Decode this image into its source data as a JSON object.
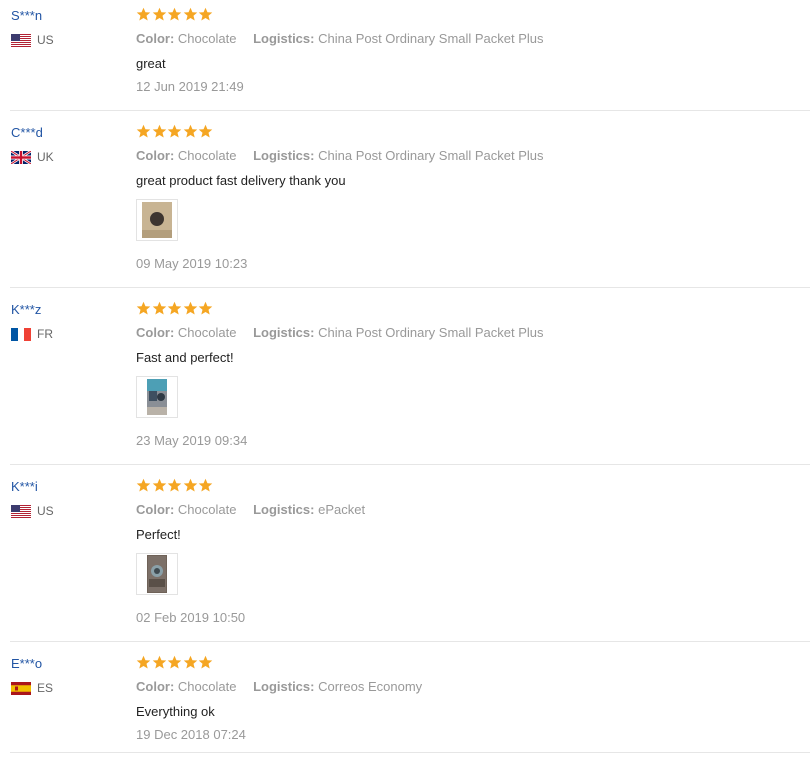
{
  "reviews": [
    {
      "name": "S***n",
      "country": "US",
      "flag_icon": "us-flag-icon",
      "rating": 5,
      "color_label": "Color:",
      "color_value": "Chocolate",
      "logistics_label": "Logistics:",
      "logistics_value": "China Post Ordinary Small Packet Plus",
      "text": "great",
      "date": "12 Jun 2019 21:49",
      "has_photo": false
    },
    {
      "name": "C***d",
      "country": "UK",
      "flag_icon": "uk-flag-icon",
      "rating": 5,
      "color_label": "Color:",
      "color_value": "Chocolate",
      "logistics_label": "Logistics:",
      "logistics_value": "China Post Ordinary Small Packet Plus",
      "text": "great product fast delivery thank you",
      "date": "09 May 2019 10:23",
      "has_photo": true
    },
    {
      "name": "K***z",
      "country": "FR",
      "flag_icon": "fr-flag-icon",
      "rating": 5,
      "color_label": "Color:",
      "color_value": "Chocolate",
      "logistics_label": "Logistics:",
      "logistics_value": "China Post Ordinary Small Packet Plus",
      "text": "Fast and perfect!",
      "date": "23 May 2019 09:34",
      "has_photo": true
    },
    {
      "name": "K***i",
      "country": "US",
      "flag_icon": "us-flag-icon",
      "rating": 5,
      "color_label": "Color:",
      "color_value": "Chocolate",
      "logistics_label": "Logistics:",
      "logistics_value": "ePacket",
      "text": "Perfect!",
      "date": "02 Feb 2019 10:50",
      "has_photo": true
    },
    {
      "name": "E***o",
      "country": "ES",
      "flag_icon": "es-flag-icon",
      "rating": 5,
      "color_label": "Color:",
      "color_value": "Chocolate",
      "logistics_label": "Logistics:",
      "logistics_value": "Correos Economy",
      "text": "Everything ok",
      "date": "19 Dec 2018 07:24",
      "has_photo": false
    }
  ],
  "colors": {
    "star": "#f5a623",
    "name_link": "#2255a4",
    "muted": "#999999",
    "divider": "#e6e6e6"
  }
}
